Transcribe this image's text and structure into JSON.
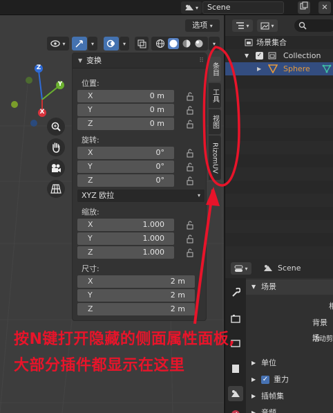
{
  "topbar": {
    "scene_label": "Scene"
  },
  "viewport": {
    "select_menu": "选项",
    "gizmo": {
      "z": "Z",
      "y": "Y",
      "x": "X"
    }
  },
  "npanel": {
    "transform_title": "变换",
    "location": {
      "label": "位置:",
      "rows": [
        {
          "axis": "X",
          "value": "0 m"
        },
        {
          "axis": "Y",
          "value": "0 m"
        },
        {
          "axis": "Z",
          "value": "0 m"
        }
      ]
    },
    "rotation": {
      "label": "旋转:",
      "rows": [
        {
          "axis": "X",
          "value": "0°"
        },
        {
          "axis": "Y",
          "value": "0°"
        },
        {
          "axis": "Z",
          "value": "0°"
        }
      ]
    },
    "rotation_mode": "XYZ 欧拉",
    "scale": {
      "label": "缩放:",
      "rows": [
        {
          "axis": "X",
          "value": "1.000"
        },
        {
          "axis": "Y",
          "value": "1.000"
        },
        {
          "axis": "Z",
          "value": "1.000"
        }
      ]
    },
    "dimensions": {
      "label": "尺寸:",
      "rows": [
        {
          "axis": "X",
          "value": "2 m"
        },
        {
          "axis": "Y",
          "value": "2 m"
        },
        {
          "axis": "Z",
          "value": "2 m"
        }
      ]
    },
    "tabs": [
      "条目",
      "工具",
      "视图",
      "RizomUV"
    ]
  },
  "outliner": {
    "scene_collection": "场景集合",
    "collection": "Collection",
    "object": "Sphere"
  },
  "properties": {
    "scene_name": "Scene",
    "scene_panel": "场景",
    "camera_clip": "相",
    "background_scene": "背景场",
    "active_clip": "活动剪",
    "units": "单位",
    "gravity": "重力",
    "keying_sets": "插帧集",
    "audio": "音频"
  },
  "annotation": {
    "line1": "按N键打开隐藏的侧面属性面板,",
    "line2": "大部分插件都显示在这里"
  },
  "colors": {
    "accent_blue": "#4772b3",
    "annotation_red": "#e8142a",
    "object_orange": "#e69a3c"
  }
}
